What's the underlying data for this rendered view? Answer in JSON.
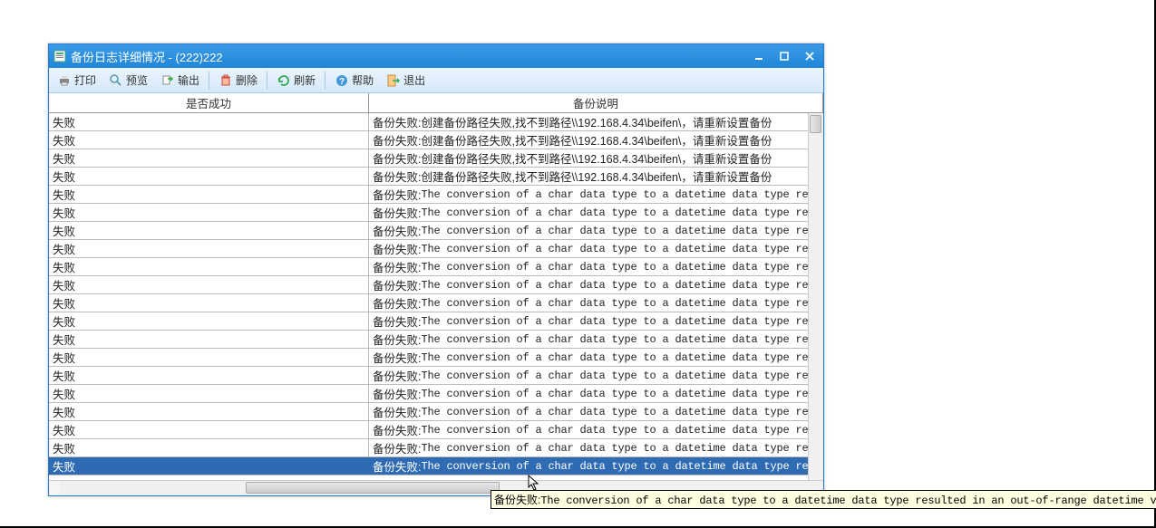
{
  "window": {
    "title": "备份日志详细情况 -  (222)222"
  },
  "toolbar": {
    "print": "打印",
    "preview": "预览",
    "export": "输出",
    "delete": "删除",
    "refresh": "刷新",
    "help": "帮助",
    "exit": "退出"
  },
  "columns": {
    "status": "是否成功",
    "desc": "备份说明"
  },
  "rows": [
    {
      "status": "失败",
      "desc": "备份失败:创建备份路径失败,找不到路径\\\\192.168.4.34\\beifen\\，请重新设置备份"
    },
    {
      "status": "失败",
      "desc": "备份失败:创建备份路径失败,找不到路径\\\\192.168.4.34\\beifen\\，请重新设置备份"
    },
    {
      "status": "失败",
      "desc": "备份失败:创建备份路径失败,找不到路径\\\\192.168.4.34\\beifen\\，请重新设置备份"
    },
    {
      "status": "失败",
      "desc": "备份失败:创建备份路径失败,找不到路径\\\\192.168.4.34\\beifen\\，请重新设置备份"
    },
    {
      "status": "失败",
      "desc": "备份失败:The conversion of a char data type to a datetime data type resul",
      "mono": true
    },
    {
      "status": "失败",
      "desc": "备份失败:The conversion of a char data type to a datetime data type resul",
      "mono": true
    },
    {
      "status": "失败",
      "desc": "备份失败:The conversion of a char data type to a datetime data type resul",
      "mono": true
    },
    {
      "status": "失败",
      "desc": "备份失败:The conversion of a char data type to a datetime data type resul",
      "mono": true
    },
    {
      "status": "失败",
      "desc": "备份失败:The conversion of a char data type to a datetime data type resul",
      "mono": true
    },
    {
      "status": "失败",
      "desc": "备份失败:The conversion of a char data type to a datetime data type resul",
      "mono": true
    },
    {
      "status": "失败",
      "desc": "备份失败:The conversion of a char data type to a datetime data type resul",
      "mono": true
    },
    {
      "status": "失败",
      "desc": "备份失败:The conversion of a char data type to a datetime data type resul",
      "mono": true
    },
    {
      "status": "失败",
      "desc": "备份失败:The conversion of a char data type to a datetime data type resul",
      "mono": true
    },
    {
      "status": "失败",
      "desc": "备份失败:The conversion of a char data type to a datetime data type resul",
      "mono": true
    },
    {
      "status": "失败",
      "desc": "备份失败:The conversion of a char data type to a datetime data type resul",
      "mono": true
    },
    {
      "status": "失败",
      "desc": "备份失败:The conversion of a char data type to a datetime data type resul",
      "mono": true
    },
    {
      "status": "失败",
      "desc": "备份失败:The conversion of a char data type to a datetime data type resul",
      "mono": true
    },
    {
      "status": "失败",
      "desc": "备份失败:The conversion of a char data type to a datetime data type resul",
      "mono": true
    },
    {
      "status": "失败",
      "desc": "备份失败:The conversion of a char data type to a datetime data type resul",
      "mono": true
    },
    {
      "status": "失败",
      "desc": "备份失败:The conversion of a char data type to a datetime data type resul",
      "mono": true,
      "selected": true
    }
  ],
  "tooltip": {
    "prefix": "备份失败:",
    "text": "The conversion of a char data type to a datetime data type resulted in an out-of-range datetime value."
  }
}
